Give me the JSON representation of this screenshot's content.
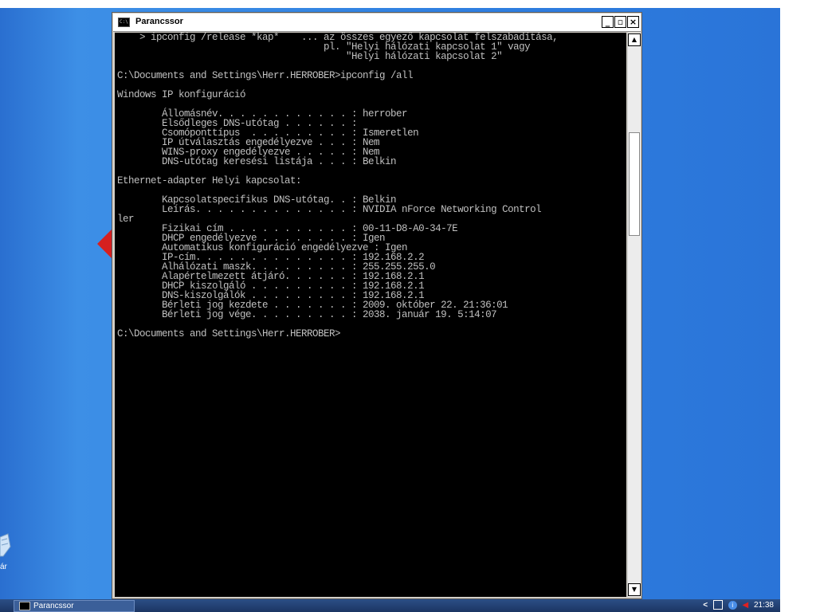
{
  "window": {
    "title": "Parancssor",
    "min_glyph": "_",
    "max_glyph": "▫",
    "close_glyph": "×",
    "icon_label": "C:\\"
  },
  "console_text": "    > ipconfig /release *kap*    ... az összes egyező kapcsolat felszabadítása,\n                                     pl. \"Helyi hálózati kapcsolat 1\" vagy\n                                         \"Helyi hálózati kapcsolat 2\"\n\nC:\\Documents and Settings\\Herr.HERROBER>ipconfig /all\n\nWindows IP konfiguráció\n\n        Állomásnév. . . . . . . . . . . . : herrober\n        Elsődleges DNS-utótag . . . . . . :\n        Csomóponttípus  . . . . . . . . . : Ismeretlen\n        IP útválasztás engedélyezve . . . : Nem\n        WINS-proxy engedélyezve . . . . . : Nem\n        DNS-utótag keresési listája . . . : Belkin\n\nEthernet-adapter Helyi kapcsolat:\n\n        Kapcsolatspecifikus DNS-utótag. . : Belkin\n        Leírás. . . . . . . . . . . . . . : NVIDIA nForce Networking Control\nler\n        Fizikai cím . . . . . . . . . . . : 00-11-D8-A0-34-7E\n        DHCP engedélyezve . . . . . . . . : Igen\n        Automatikus konfiguráció engedélyezve : Igen\n        IP-cím. . . . . . . . . . . . . . : 192.168.2.2\n        Alhálózati maszk. . . . . . . . . : 255.255.255.0\n        Alapértelmezett átjáró. . . . . . : 192.168.2.1\n        DHCP kiszolgáló . . . . . . . . . : 192.168.2.1\n        DNS-kiszolgálók . . . . . . . . . : 192.168.2.1\n        Bérleti jog kezdete . . . . . . . : 2009. október 22. 21:36:01\n        Bérleti jog vége. . . . . . . . . : 2038. január 19. 5:14:07\n\nC:\\Documents and Settings\\Herr.HERROBER>",
  "scrollbar": {
    "up_glyph": "▲",
    "down_glyph": "▼"
  },
  "desktop": {
    "icon_label": "ár"
  },
  "taskbar": {
    "task_label": "Parancssor",
    "tray_arrow": "<",
    "tray_info": "i",
    "tray_volume": "◀",
    "clock": "21:38"
  },
  "colors": {
    "console_bg": "#000000",
    "console_fg": "#c0c0c0",
    "desktop": "#2f7fe0",
    "taskbar": "#1b3563"
  },
  "icons": [
    "cmd-icon",
    "minimize-icon",
    "maximize-icon",
    "close-icon",
    "scroll-up-icon",
    "scroll-down-icon",
    "recycle-bin-icon",
    "network-icon",
    "info-icon",
    "volume-icon"
  ]
}
